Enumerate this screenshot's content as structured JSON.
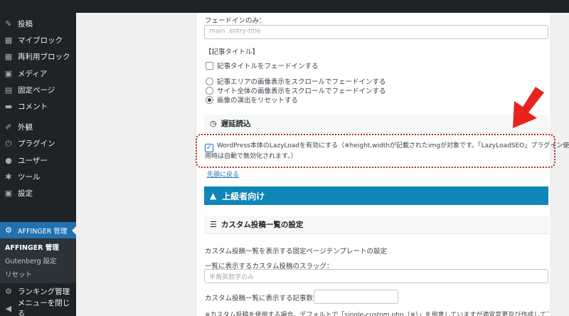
{
  "sidebar": {
    "items": [
      {
        "icon": "pin-icon",
        "label": "投稿"
      },
      {
        "icon": "grid-icon",
        "label": "マイブロック"
      },
      {
        "icon": "grid-icon",
        "label": "再利用ブロック"
      },
      {
        "icon": "media-icon",
        "label": "メディア"
      },
      {
        "icon": "page-icon",
        "label": "固定ページ"
      },
      {
        "icon": "comment-icon",
        "label": "コメント"
      },
      {
        "icon": "brush-icon",
        "label": "外観"
      },
      {
        "icon": "plugin-icon",
        "label": "プラグイン"
      },
      {
        "icon": "user-icon",
        "label": "ユーザー"
      },
      {
        "icon": "wrench-icon",
        "label": "ツール"
      },
      {
        "icon": "settings-icon",
        "label": "設定"
      }
    ],
    "active_item": {
      "icon": "gear-icon",
      "label": "AFFINGER 管理"
    },
    "submenu": [
      "AFFINGER 管理",
      "Gutenberg 設定",
      "リセット"
    ],
    "after_items": [
      {
        "icon": "gear-icon",
        "label": "ランキング管理"
      },
      {
        "icon": "collapse-icon",
        "label": "メニューを閉じる"
      }
    ]
  },
  "content": {
    "fadein_label": "フェードインのみ：",
    "fadein_placeholder": "main .entry-title",
    "article_title_heading": "【記事タイトル】",
    "title_fadein_checkbox": "記事タイトルをフェードインする",
    "radios": [
      "記事エリアの画像表示をスクロールでフェードインする",
      "サイト全体の画像表示をスクロールでフェードインする",
      "画像の演出をリセットする"
    ],
    "lazy_section_title": "遅延読込",
    "lazy_checkbox_line1": "WordPress本体のLazyLoadを有効にする（※height,widthが記載されたimgが対象です。「LazyLoadSEO」プラグイン使",
    "lazy_checkbox_line2": "用時は自動で無効化されます。）",
    "back_to_top": "先頭に戻る",
    "advanced_title": "上級者向け",
    "custom_post_section_title": "カスタム投稿一覧の設定",
    "custom_post_desc": "カスタム投稿一覧を表示する固定ページテンプレートの設定",
    "slug_label": "一覧に表示するカスタム投稿のスラッグ：",
    "slug_placeholder": "半角英数字のみ",
    "count_label": "カスタム投稿一覧に表示する記事数：",
    "bottom_note": "※カスタム投稿を使用する場合、デフォルトで「single-custom.php（※）」を用意していますが適宜変更及び作成して下さ"
  },
  "colors": {
    "sidebar_bg": "#1d2327",
    "active_blue": "#2271b1",
    "advanced_bar": "#0f86b8",
    "highlight": "#b3261e",
    "arrow": "#e8231e"
  }
}
